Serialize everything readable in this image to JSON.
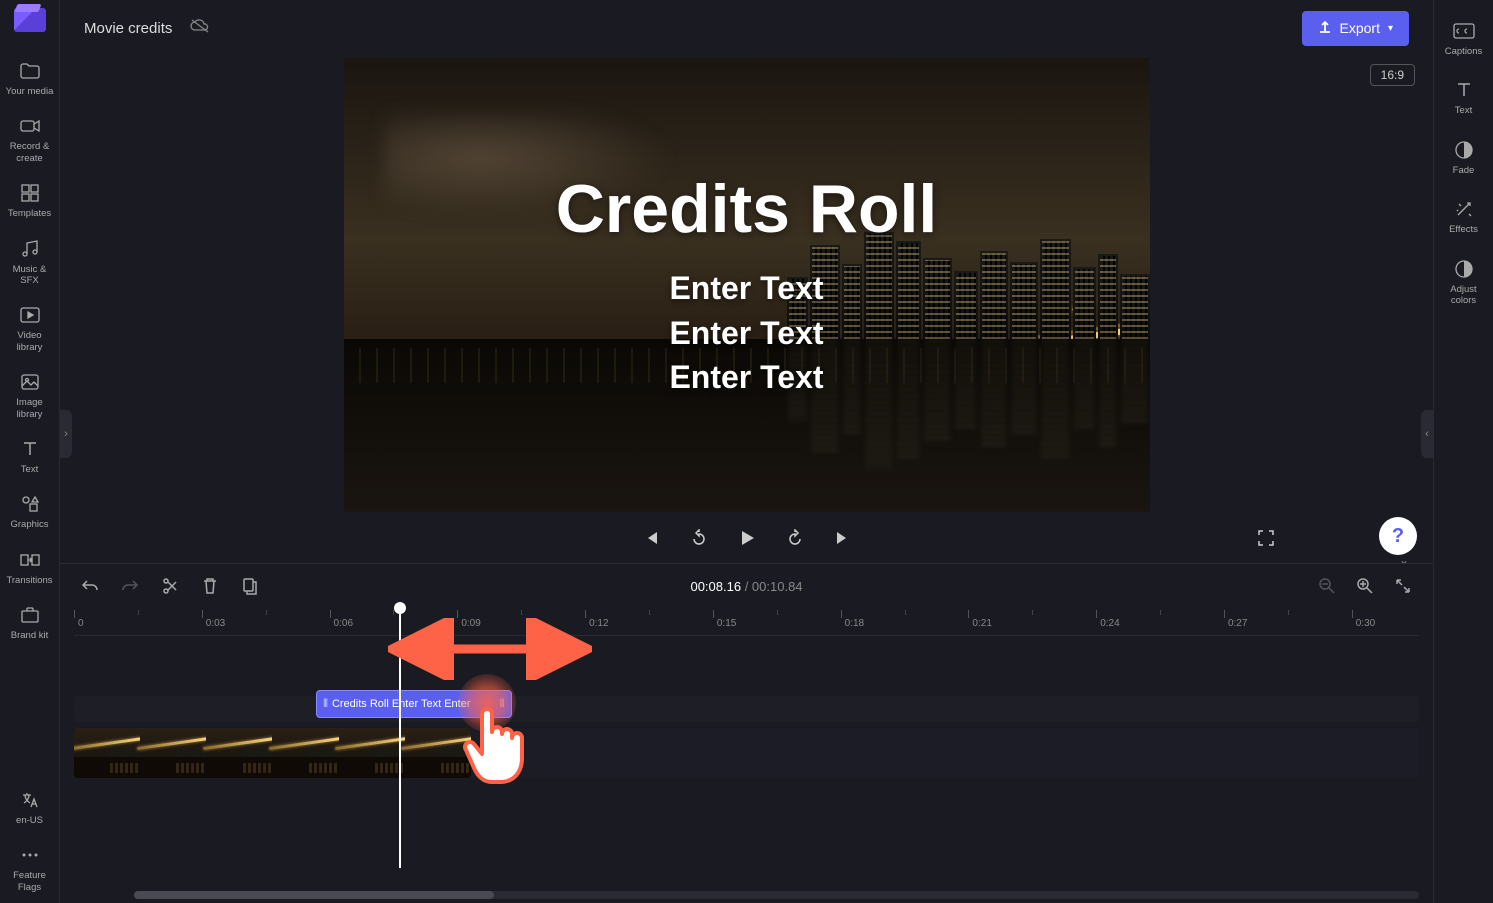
{
  "header": {
    "project_title": "Movie credits",
    "export_label": "Export",
    "aspect_ratio": "16:9"
  },
  "left_nav": {
    "items": [
      {
        "id": "your-media",
        "label": "Your media"
      },
      {
        "id": "record-create",
        "label": "Record & create"
      },
      {
        "id": "templates",
        "label": "Templates"
      },
      {
        "id": "music-sfx",
        "label": "Music & SFX"
      },
      {
        "id": "video-library",
        "label": "Video library"
      },
      {
        "id": "image-library",
        "label": "Image library"
      },
      {
        "id": "text",
        "label": "Text"
      },
      {
        "id": "graphics",
        "label": "Graphics"
      },
      {
        "id": "transitions",
        "label": "Transitions"
      },
      {
        "id": "brand-kit",
        "label": "Brand kit"
      }
    ],
    "bottom_items": [
      {
        "id": "locale",
        "label": "en-US"
      },
      {
        "id": "feature-flags",
        "label": "Feature Flags"
      }
    ]
  },
  "right_nav": {
    "items": [
      {
        "id": "captions",
        "label": "Captions"
      },
      {
        "id": "text",
        "label": "Text"
      },
      {
        "id": "fade",
        "label": "Fade"
      },
      {
        "id": "effects",
        "label": "Effects"
      },
      {
        "id": "adjust-colors",
        "label": "Adjust colors"
      }
    ]
  },
  "preview": {
    "title": "Credits Roll",
    "lines": [
      "Enter Text",
      "Enter Text",
      "Enter Text"
    ]
  },
  "timeline": {
    "current_time": "00:08.16",
    "total_time": "00:10.84",
    "ruler": [
      "0",
      "0:03",
      "0:06",
      "0:09",
      "0:12",
      "0:15",
      "0:18",
      "0:21",
      "0:24",
      "0:27",
      "0:30"
    ],
    "text_clip_label": "Credits Roll Enter Text Enter",
    "playhead_pct": 24.2,
    "text_clip": {
      "start_pct": 18.0,
      "width_pct": 14.6
    },
    "video_clip": {
      "start_pct": 0,
      "width_pct": 29.5
    }
  },
  "help": {
    "glyph": "?"
  }
}
